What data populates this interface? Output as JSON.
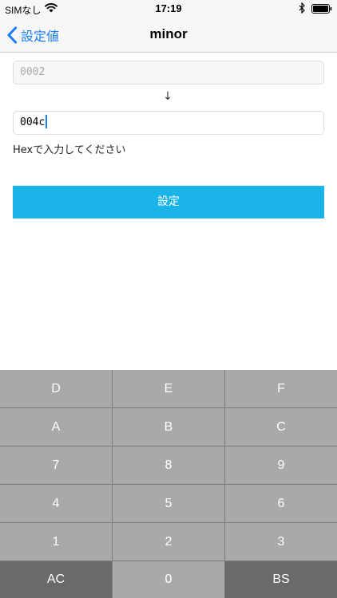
{
  "status": {
    "carrier": "SIMなし",
    "time": "17:19"
  },
  "nav": {
    "back_label": "設定値",
    "title": "minor"
  },
  "form": {
    "current_value": "0002",
    "arrow": "↓",
    "new_value": "004c",
    "hint": "Hexで入力してください",
    "submit_label": "設定"
  },
  "keypad": {
    "keys": [
      "D",
      "E",
      "F",
      "A",
      "B",
      "C",
      "7",
      "8",
      "9",
      "4",
      "5",
      "6",
      "1",
      "2",
      "3",
      "AC",
      "0",
      "BS"
    ]
  },
  "colors": {
    "accent": "#1a7cf5",
    "button": "#1ab4e8",
    "key": "#a9a9a9",
    "key_dark": "#6a6a6a"
  }
}
